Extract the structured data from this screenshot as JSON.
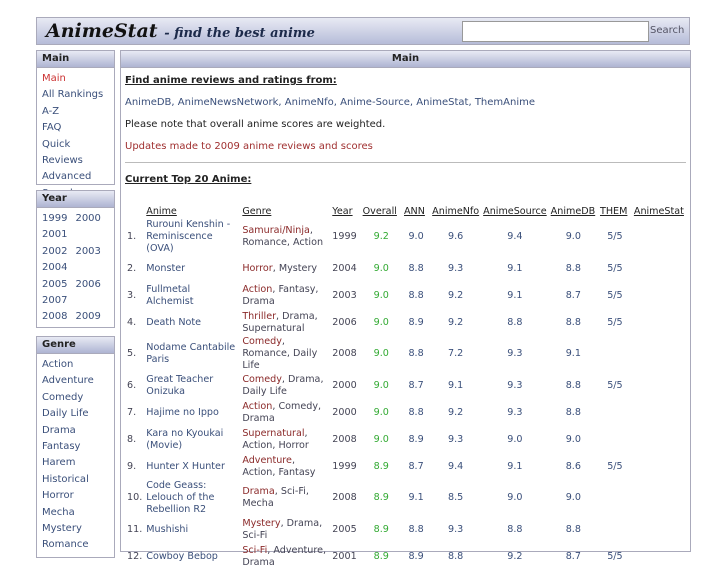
{
  "header": {
    "logo": "AnimeStat",
    "tagline": "- find the best anime",
    "search_placeholder": "",
    "search_label": "Search"
  },
  "sidebar": {
    "main": {
      "title": "Main",
      "items": [
        "Main",
        "All Rankings",
        "A-Z",
        "FAQ",
        "Quick Reviews",
        "Advanced Search"
      ]
    },
    "year": {
      "title": "Year",
      "rows": [
        [
          "1999",
          "2000"
        ],
        [
          "2001"
        ],
        [
          "2002",
          "2003"
        ],
        [
          "2004"
        ],
        [
          "2005",
          "2006"
        ],
        [
          "2007"
        ],
        [
          "2008",
          "2009"
        ]
      ]
    },
    "genre": {
      "title": "Genre",
      "items": [
        "Action",
        "Adventure",
        "Comedy",
        "Daily Life",
        "Drama",
        "Fantasy",
        "Harem",
        "Historical",
        "Horror",
        "Mecha",
        "Mystery",
        "Romance"
      ]
    }
  },
  "main": {
    "title": "Main",
    "find_heading": "Find anime reviews and ratings from:",
    "sources": [
      "AnimeDB",
      "AnimeNewsNetwork",
      "AnimeNfo",
      "Anime-Source",
      "AnimeStat",
      "ThemAnime"
    ],
    "note": "Please note that overall anime scores are weighted.",
    "update": "Updates made to 2009 anime reviews and scores",
    "top_heading": "Current Top 20 Anime:",
    "columns": [
      "",
      "Anime",
      "Genre",
      "Year",
      "Overall",
      "ANN",
      "AnimeNfo",
      "AnimeSource",
      "AnimeDB",
      "THEM",
      "AnimeStat"
    ],
    "rows": [
      [
        "1.",
        "Rurouni Kenshin - Reminiscence (OVA)",
        "Samurai/Ninja",
        ", Romance, Action",
        "1999",
        "9.2",
        "9.0",
        "9.6",
        "9.4",
        "9.0",
        "5/5",
        ""
      ],
      [
        "2.",
        "Monster",
        "Horror",
        ", Mystery",
        "2004",
        "9.0",
        "8.8",
        "9.3",
        "9.1",
        "8.8",
        "5/5",
        ""
      ],
      [
        "3.",
        "Fullmetal Alchemist",
        "Action",
        ", Fantasy, Drama",
        "2003",
        "9.0",
        "8.8",
        "9.2",
        "9.1",
        "8.7",
        "5/5",
        ""
      ],
      [
        "4.",
        "Death Note",
        "Thriller",
        ", Drama, Supernatural",
        "2006",
        "9.0",
        "8.9",
        "9.2",
        "8.8",
        "8.8",
        "5/5",
        ""
      ],
      [
        "5.",
        "Nodame Cantabile Paris",
        "Comedy",
        ", Romance, Daily Life",
        "2008",
        "9.0",
        "8.8",
        "7.2",
        "9.3",
        "9.1",
        "",
        ""
      ],
      [
        "6.",
        "Great Teacher Onizuka",
        "Comedy",
        ", Drama, Daily Life",
        "2000",
        "9.0",
        "8.7",
        "9.1",
        "9.3",
        "8.8",
        "5/5",
        ""
      ],
      [
        "7.",
        "Hajime no Ippo",
        "Action",
        ", Comedy, Drama",
        "2000",
        "9.0",
        "8.8",
        "9.2",
        "9.3",
        "8.8",
        "",
        ""
      ],
      [
        "8.",
        "Kara no Kyoukai (Movie)",
        "Supernatural",
        ", Action, Horror",
        "2008",
        "9.0",
        "8.9",
        "9.3",
        "9.0",
        "9.0",
        "",
        ""
      ],
      [
        "9.",
        "Hunter X Hunter",
        "Adventure",
        ", Action, Fantasy",
        "1999",
        "8.9",
        "8.7",
        "9.4",
        "9.1",
        "8.6",
        "5/5",
        ""
      ],
      [
        "10.",
        "Code Geass: Lelouch of the Rebellion R2",
        "Drama",
        ", Sci-Fi, Mecha",
        "2008",
        "8.9",
        "9.1",
        "8.5",
        "9.0",
        "9.0",
        "",
        ""
      ],
      [
        "11.",
        "Mushishi",
        "Mystery",
        ", Drama, Sci-Fi",
        "2005",
        "8.9",
        "8.8",
        "9.3",
        "8.8",
        "8.8",
        "",
        ""
      ],
      [
        "12.",
        "Cowboy Bebop",
        "Sci-Fi",
        ", Adventure, Drama",
        "2001",
        "8.9",
        "8.9",
        "8.8",
        "9.2",
        "8.7",
        "5/5",
        ""
      ]
    ]
  }
}
